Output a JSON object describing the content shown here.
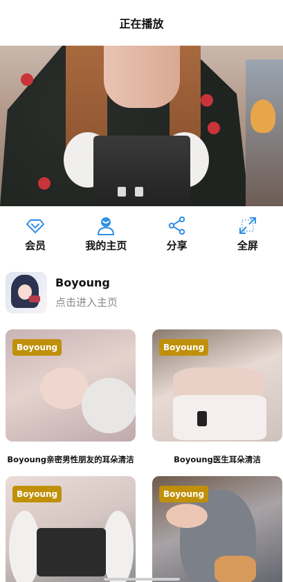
{
  "header": {
    "title": "正在播放"
  },
  "actions": [
    {
      "label": "会员",
      "icon": "diamond-icon"
    },
    {
      "label": "我的主页",
      "icon": "user-icon"
    },
    {
      "label": "分享",
      "icon": "share-icon"
    },
    {
      "label": "全屏",
      "icon": "fullscreen-icon"
    }
  ],
  "author": {
    "name": "Boyoung",
    "subtitle": "点击进入主页"
  },
  "videos": [
    {
      "badge": "Boyoung",
      "title": "Boyoung亲密男性朋友的耳朵清洁"
    },
    {
      "badge": "Boyoung",
      "title": "Boyoung医生耳朵清洁"
    },
    {
      "badge": "Boyoung",
      "title": ""
    },
    {
      "badge": "Boyoung",
      "title": ""
    }
  ],
  "colors": {
    "accent": "#2f8fe6",
    "badge": "#c0900a"
  }
}
